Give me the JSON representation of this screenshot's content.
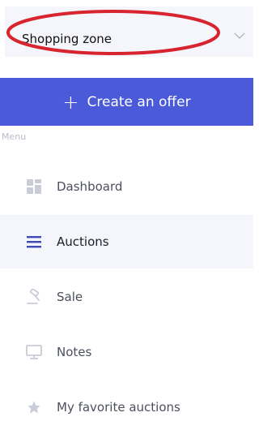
{
  "zone_select": {
    "value": "Shopping zone",
    "chevron_icon": "chevron-down-icon"
  },
  "create_button": {
    "icon": "plus-icon",
    "label": "Create an offer"
  },
  "menu": {
    "heading": "Menu",
    "items": [
      {
        "label": "Dashboard",
        "icon": "dashboard-grid-icon",
        "active": false
      },
      {
        "label": "Auctions",
        "icon": "hamburger-list-icon",
        "active": true
      },
      {
        "label": "Sale",
        "icon": "gavel-icon",
        "active": false
      },
      {
        "label": "Notes",
        "icon": "monitor-icon",
        "active": false
      },
      {
        "label": "My favorite auctions",
        "icon": "star-icon",
        "active": false
      }
    ]
  },
  "colors": {
    "accent": "#4a5ad8",
    "annotation_ellipse": "#d7242f",
    "muted_icon": "#c9ccd6",
    "active_icon": "#3d4ab8",
    "panel_bg": "#f5f6fb"
  }
}
